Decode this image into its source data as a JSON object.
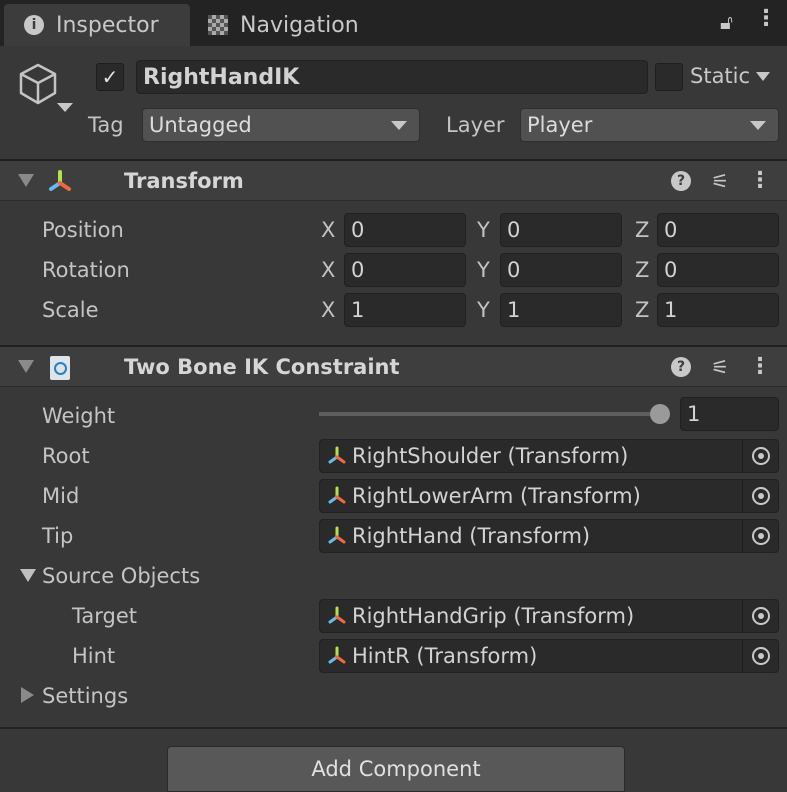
{
  "tabs": [
    {
      "label": "Inspector",
      "icon": "info-icon"
    },
    {
      "label": "Navigation",
      "icon": "navigation-icon"
    }
  ],
  "object": {
    "active": true,
    "name": "RightHandIK",
    "static_label": "Static",
    "static": false,
    "tag_label": "Tag",
    "tag": "Untagged",
    "layer_label": "Layer",
    "layer": "Player"
  },
  "transform": {
    "title": "Transform",
    "rows": [
      {
        "label": "Position",
        "x": "0",
        "y": "0",
        "z": "0"
      },
      {
        "label": "Rotation",
        "x": "0",
        "y": "0",
        "z": "0"
      },
      {
        "label": "Scale",
        "x": "1",
        "y": "1",
        "z": "1"
      }
    ]
  },
  "axes": {
    "x": "X",
    "y": "Y",
    "z": "Z"
  },
  "ik": {
    "title": "Two Bone IK Constraint",
    "weight_label": "Weight",
    "weight": "1",
    "weight_fraction": 1.0,
    "root_label": "Root",
    "root": "RightShoulder (Transform)",
    "mid_label": "Mid",
    "mid": "RightLowerArm (Transform)",
    "tip_label": "Tip",
    "tip": "RightHand (Transform)",
    "source_label": "Source Objects",
    "target_label": "Target",
    "target": "RightHandGrip (Transform)",
    "hint_label": "Hint",
    "hint": "HintR (Transform)",
    "settings_label": "Settings"
  },
  "add_component": "Add Component"
}
